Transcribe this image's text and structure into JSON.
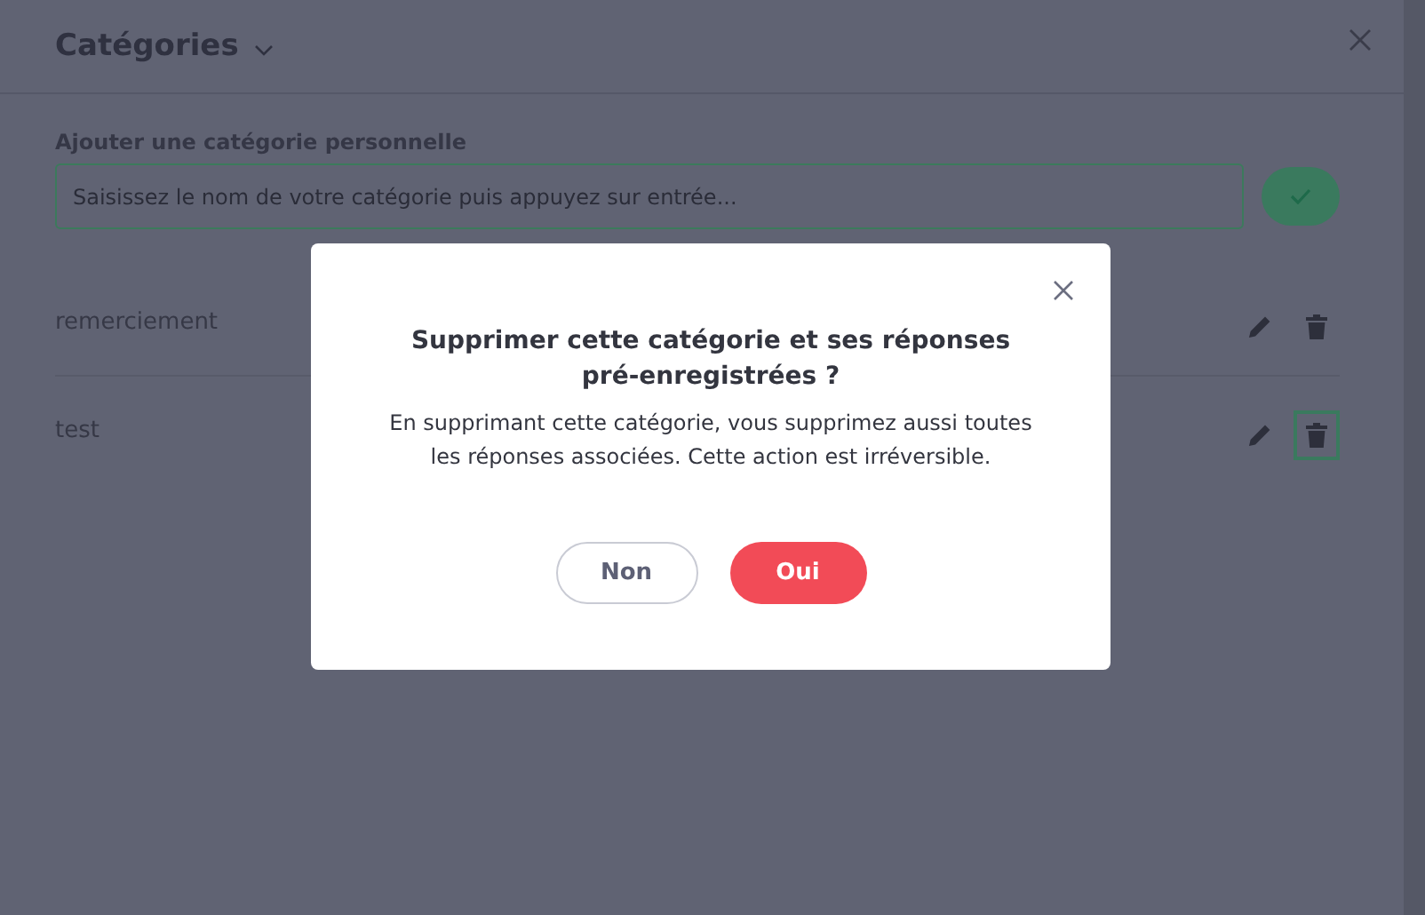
{
  "panel": {
    "title": "Catégories",
    "add_label": "Ajouter une catégorie personnelle",
    "add_field": {
      "placeholder": "Saisissez le nom de votre catégorie puis appuyez sur entrée..."
    },
    "categories": [
      {
        "name": "remerciement",
        "delete_focused": false
      },
      {
        "name": "test",
        "delete_focused": true
      }
    ]
  },
  "dialog": {
    "title": "Supprimer cette catégorie et ses réponses pré-enregistrées ?",
    "message": "En supprimant cette catégorie, vous supprimez aussi toutes les réponses associées. Cette action est irréversible.",
    "buttons": [
      {
        "label": "Non",
        "kind": "secondary"
      },
      {
        "label": "Oui",
        "kind": "danger"
      }
    ]
  }
}
